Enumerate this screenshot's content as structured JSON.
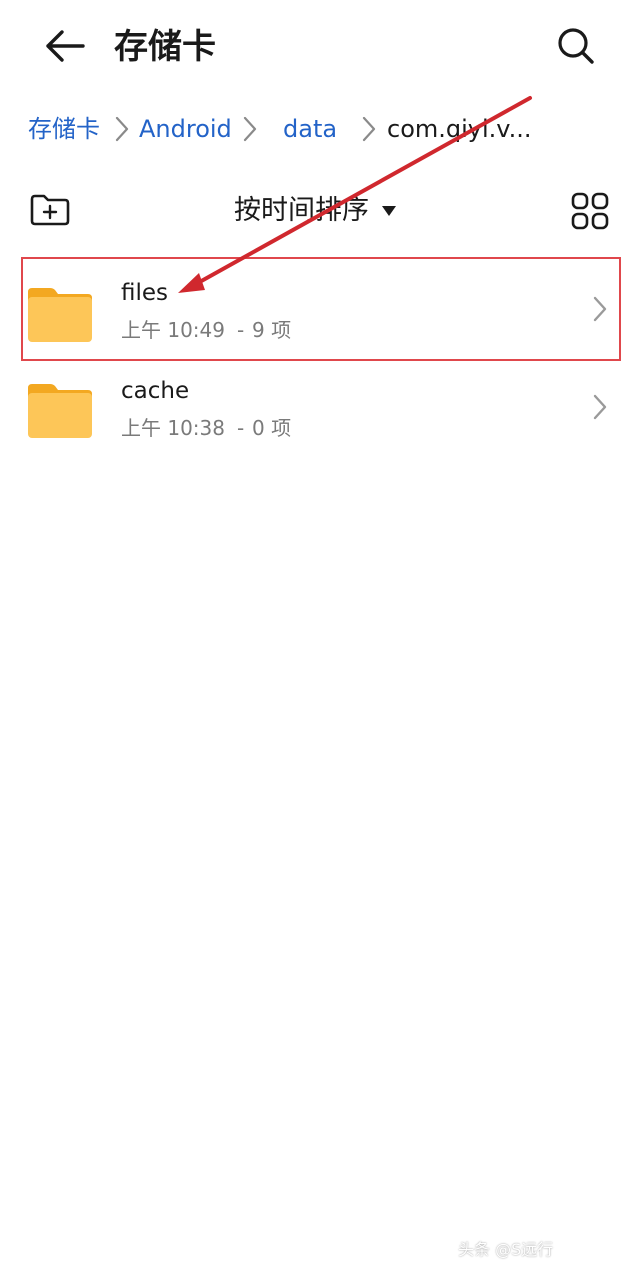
{
  "header": {
    "title": "存储卡",
    "back_icon": "arrow-left-icon",
    "search_icon": "search-icon"
  },
  "breadcrumb": {
    "items": [
      "存储卡",
      "Android",
      "data",
      "com.qiyi.v..."
    ],
    "link_color": "#2363c8"
  },
  "toolbar": {
    "new_folder_icon": "folder-add-icon",
    "sort_label": "按时间排序",
    "sort_caret_icon": "caret-down-icon",
    "view_icon": "grid-view-icon"
  },
  "files": [
    {
      "name": "files",
      "time": "上午 10:49",
      "count": "9 项",
      "icon": "folder-icon"
    },
    {
      "name": "cache",
      "time": "上午 10:38",
      "count": "0 项",
      "icon": "folder-icon"
    }
  ],
  "annotation": {
    "highlight_color": "#e0474c",
    "arrow_color": "#d0282e"
  },
  "watermark": "头条 @S远行"
}
